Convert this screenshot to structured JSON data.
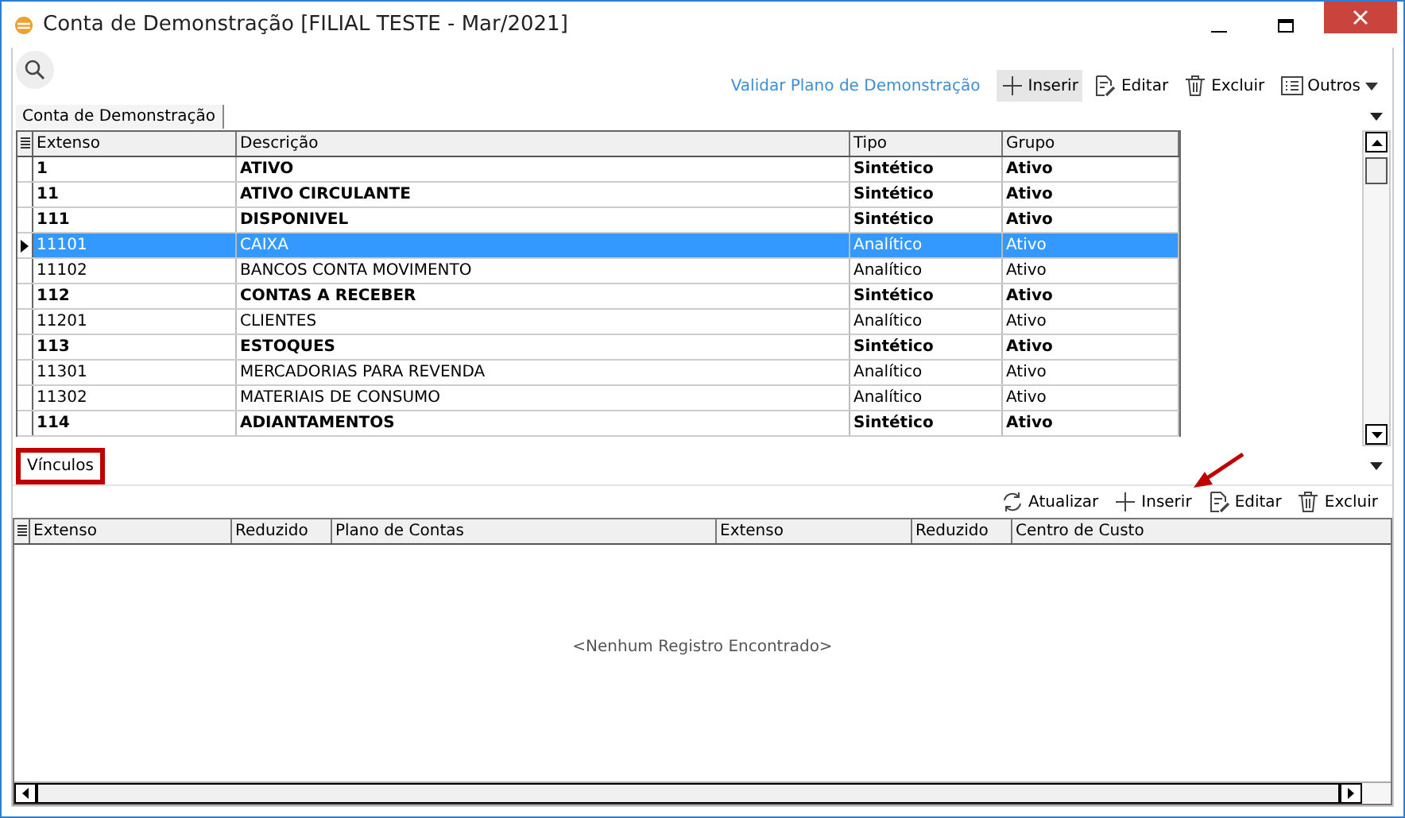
{
  "window": {
    "title": "Conta de Demonstração [FILIAL TESTE - Mar/2021]"
  },
  "toolbar": {
    "link": "Validar Plano de Demonstração",
    "buttons": [
      {
        "kind": "add",
        "label": "Inserir",
        "hovered": true
      },
      {
        "kind": "edit",
        "label": "Editar",
        "hovered": false
      },
      {
        "kind": "delete",
        "label": "Excluir",
        "hovered": false
      },
      {
        "kind": "list",
        "label": "Outros",
        "hovered": false
      }
    ]
  },
  "tabs": [
    {
      "label": "Conta de Demonstração",
      "selected": true
    }
  ],
  "table": {
    "columns": [
      "Extenso",
      "Descrição",
      "Tipo",
      "Grupo"
    ],
    "rows": [
      {
        "kind": "synthetic",
        "selected": false,
        "cells": [
          "1",
          "ATIVO",
          "Sintético",
          "Ativo"
        ]
      },
      {
        "kind": "synthetic",
        "selected": false,
        "cells": [
          "11",
          "ATIVO CIRCULANTE",
          "Sintético",
          "Ativo"
        ]
      },
      {
        "kind": "synthetic",
        "selected": false,
        "cells": [
          "111",
          "DISPONIVEL",
          "Sintético",
          "Ativo"
        ]
      },
      {
        "kind": "analytic",
        "selected": true,
        "cells": [
          "11101",
          "CAIXA",
          "Analítico",
          "Ativo"
        ]
      },
      {
        "kind": "analytic",
        "selected": false,
        "cells": [
          "11102",
          "BANCOS CONTA MOVIMENTO",
          "Analítico",
          "Ativo"
        ]
      },
      {
        "kind": "synthetic",
        "selected": false,
        "cells": [
          "112",
          "CONTAS A RECEBER",
          "Sintético",
          "Ativo"
        ]
      },
      {
        "kind": "analytic",
        "selected": false,
        "cells": [
          "11201",
          "CLIENTES",
          "Analítico",
          "Ativo"
        ]
      },
      {
        "kind": "synthetic",
        "selected": false,
        "cells": [
          "113",
          "ESTOQUES",
          "Sintético",
          "Ativo"
        ]
      },
      {
        "kind": "analytic",
        "selected": false,
        "cells": [
          "11301",
          "MERCADORIAS PARA REVENDA",
          "Analítico",
          "Ativo"
        ]
      },
      {
        "kind": "analytic",
        "selected": false,
        "cells": [
          "11302",
          "MATERIAIS DE CONSUMO",
          "Analítico",
          "Ativo"
        ]
      },
      {
        "kind": "synthetic",
        "selected": false,
        "cells": [
          "114",
          "ADIANTAMENTOS",
          "Sintético",
          "Ativo"
        ]
      }
    ]
  },
  "links_section": {
    "tab": {
      "label": "Vínculos",
      "highlighted": true
    },
    "annotation_arrow": true,
    "buttons": [
      {
        "kind": "refresh",
        "label": "Atualizar"
      },
      {
        "kind": "add",
        "label": "Inserir"
      },
      {
        "kind": "edit",
        "label": "Editar"
      },
      {
        "kind": "delete",
        "label": "Excluir"
      }
    ],
    "columns": [
      "Extenso",
      "Reduzido",
      "Plano de Contas",
      "Extenso",
      "Reduzido",
      "Centro de Custo"
    ],
    "empty_message": "<Nenhum Registro Encontrado>"
  }
}
